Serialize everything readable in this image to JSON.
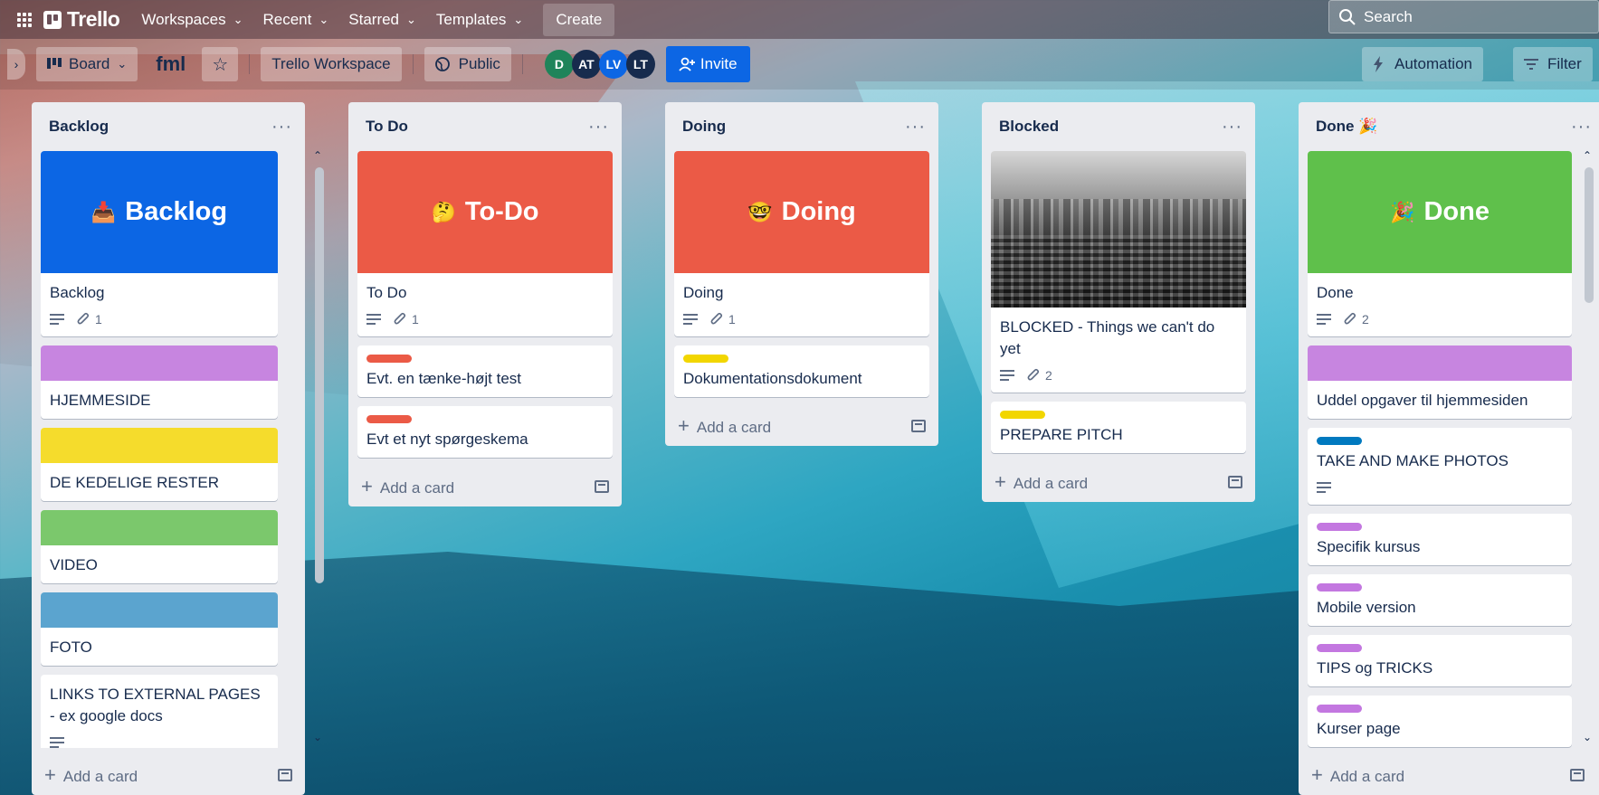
{
  "topnav": {
    "logo": "Trello",
    "menus": [
      "Workspaces",
      "Recent",
      "Starred",
      "Templates"
    ],
    "create": "Create",
    "search_placeholder": "Search"
  },
  "header": {
    "view": "Board",
    "title": "fml",
    "workspace": "Trello Workspace",
    "visibility": "Public",
    "members": [
      {
        "initials": "D",
        "color": "#1f845a"
      },
      {
        "initials": "AT",
        "color": "#172b4d"
      },
      {
        "initials": "LV",
        "color": "#0c66e4"
      },
      {
        "initials": "LT",
        "color": "#172b4d"
      }
    ],
    "invite": "Invite",
    "automation": "Automation",
    "filter": "Filter"
  },
  "add_card_label": "Add a card",
  "lists": [
    {
      "title": "Backlog",
      "cards": [
        {
          "cover_text": "Backlog",
          "cover_emoji": "📥",
          "cover_color": "#0c66e4",
          "title": "Backlog",
          "attachments": "1"
        },
        {
          "half_cover": "#c785e0",
          "title": "HJEMMESIDE"
        },
        {
          "half_cover": "#f5dc2c",
          "title": "DE KEDELIGE RESTER"
        },
        {
          "half_cover": "#7bc86c",
          "title": "VIDEO"
        },
        {
          "half_cover": "#5ba4cf",
          "title": "FOTO"
        },
        {
          "title": "LINKS TO EXTERNAL PAGES - ex google docs"
        }
      ]
    },
    {
      "title": "To Do",
      "cards": [
        {
          "cover_text": "To-Do",
          "cover_emoji": "🤔",
          "cover_color": "#eb5a46",
          "title": "To Do",
          "attachments": "1"
        },
        {
          "label": "#eb5a46",
          "title": "Evt. en tænke-højt test"
        },
        {
          "label": "#eb5a46",
          "title": "Evt et nyt spørgeskema"
        }
      ]
    },
    {
      "title": "Doing",
      "cards": [
        {
          "cover_text": "Doing",
          "cover_emoji": "🤓",
          "cover_color": "#eb5a46",
          "title": "Doing",
          "attachments": "1"
        },
        {
          "label": "#f2d600",
          "title": "Dokumentationsdokument"
        }
      ]
    },
    {
      "title": "Blocked",
      "cards": [
        {
          "title": "BLOCKED - Things we can't do yet",
          "attachments": "2"
        },
        {
          "label": "#f2d600",
          "title": "PREPARE PITCH"
        }
      ]
    },
    {
      "title": "Done",
      "title_emoji": "🎉",
      "cards": [
        {
          "cover_text": "Done",
          "cover_emoji": "🎉",
          "cover_color": "#5fc04b",
          "title": "Done",
          "attachments": "2"
        },
        {
          "half_cover": "#c785e0",
          "title": "Uddel opgaver til hjemmesiden"
        },
        {
          "label": "#0079bf",
          "title": "TAKE AND MAKE PHOTOS"
        },
        {
          "label": "#c377e0",
          "title": "Specifik kursus"
        },
        {
          "label": "#c377e0",
          "title": "Mobile version"
        },
        {
          "label": "#c377e0",
          "title": "TIPS og TRICKS"
        },
        {
          "label": "#c377e0",
          "title": "Kurser page"
        }
      ]
    }
  ]
}
